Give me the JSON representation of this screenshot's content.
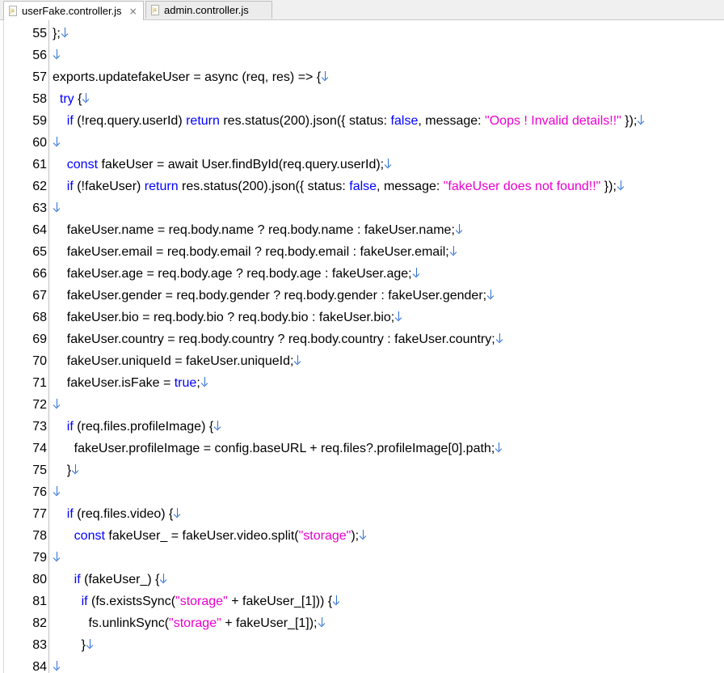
{
  "tabs": [
    {
      "label": "userFake.controller.js",
      "active": true,
      "closable": true
    },
    {
      "label": "admin.controller.js",
      "active": false,
      "closable": false
    }
  ],
  "close_glyph": "×",
  "colors": {
    "keyword": "#0000ff",
    "string": "#e800d0",
    "eol_marker": "#2b6fd6"
  },
  "lines": [
    {
      "n": "55",
      "segs": [
        [
          "t",
          "};"
        ]
      ]
    },
    {
      "n": "56",
      "segs": []
    },
    {
      "n": "57",
      "segs": [
        [
          "t",
          "exports.updatefakeUser = async (req, res) => {"
        ]
      ]
    },
    {
      "n": "58",
      "segs": [
        [
          "k",
          "  try"
        ],
        [
          "t",
          " {"
        ]
      ]
    },
    {
      "n": "59",
      "segs": [
        [
          "t",
          "    "
        ],
        [
          "k",
          "if"
        ],
        [
          "t",
          " (!req.query.userId) "
        ],
        [
          "k",
          "return"
        ],
        [
          "t",
          " res.status(200).json({ status: "
        ],
        [
          "k",
          "false"
        ],
        [
          "t",
          ", message: "
        ],
        [
          "s",
          "\"Oops ! Invalid details!!\""
        ],
        [
          "t",
          " });"
        ]
      ]
    },
    {
      "n": "60",
      "segs": []
    },
    {
      "n": "61",
      "segs": [
        [
          "t",
          "    "
        ],
        [
          "k",
          "const"
        ],
        [
          "t",
          " fakeUser = await User.findById(req.query.userId);"
        ]
      ]
    },
    {
      "n": "62",
      "segs": [
        [
          "t",
          "    "
        ],
        [
          "k",
          "if"
        ],
        [
          "t",
          " (!fakeUser) "
        ],
        [
          "k",
          "return"
        ],
        [
          "t",
          " res.status(200).json({ status: "
        ],
        [
          "k",
          "false"
        ],
        [
          "t",
          ", message: "
        ],
        [
          "s",
          "\"fakeUser does not found!!\""
        ],
        [
          "t",
          " });"
        ]
      ]
    },
    {
      "n": "63",
      "segs": []
    },
    {
      "n": "64",
      "segs": [
        [
          "t",
          "    fakeUser.name = req.body.name ? req.body.name : fakeUser.name;"
        ]
      ]
    },
    {
      "n": "65",
      "segs": [
        [
          "t",
          "    fakeUser.email = req.body.email ? req.body.email : fakeUser.email;"
        ]
      ]
    },
    {
      "n": "66",
      "segs": [
        [
          "t",
          "    fakeUser.age = req.body.age ? req.body.age : fakeUser.age;"
        ]
      ]
    },
    {
      "n": "67",
      "segs": [
        [
          "t",
          "    fakeUser.gender = req.body.gender ? req.body.gender : fakeUser.gender;"
        ]
      ]
    },
    {
      "n": "68",
      "segs": [
        [
          "t",
          "    fakeUser.bio = req.body.bio ? req.body.bio : fakeUser.bio;"
        ]
      ]
    },
    {
      "n": "69",
      "segs": [
        [
          "t",
          "    fakeUser.country = req.body.country ? req.body.country : fakeUser.country;"
        ]
      ]
    },
    {
      "n": "70",
      "segs": [
        [
          "t",
          "    fakeUser.uniqueId = fakeUser.uniqueId;"
        ]
      ]
    },
    {
      "n": "71",
      "segs": [
        [
          "t",
          "    fakeUser.isFake = "
        ],
        [
          "k",
          "true"
        ],
        [
          "t",
          ";"
        ]
      ]
    },
    {
      "n": "72",
      "segs": []
    },
    {
      "n": "73",
      "segs": [
        [
          "t",
          "    "
        ],
        [
          "k",
          "if"
        ],
        [
          "t",
          " (req.files.profileImage) {"
        ]
      ]
    },
    {
      "n": "74",
      "segs": [
        [
          "t",
          "      fakeUser.profileImage = config.baseURL + req.files?.profileImage[0].path;"
        ]
      ]
    },
    {
      "n": "75",
      "segs": [
        [
          "t",
          "    }"
        ]
      ]
    },
    {
      "n": "76",
      "segs": []
    },
    {
      "n": "77",
      "segs": [
        [
          "t",
          "    "
        ],
        [
          "k",
          "if"
        ],
        [
          "t",
          " (req.files.video) {"
        ]
      ]
    },
    {
      "n": "78",
      "segs": [
        [
          "t",
          "      "
        ],
        [
          "k",
          "const"
        ],
        [
          "t",
          " fakeUser_ = fakeUser.video.split("
        ],
        [
          "s",
          "\"storage\""
        ],
        [
          "t",
          ");"
        ]
      ]
    },
    {
      "n": "79",
      "segs": []
    },
    {
      "n": "80",
      "segs": [
        [
          "t",
          "      "
        ],
        [
          "k",
          "if"
        ],
        [
          "t",
          " (fakeUser_) {"
        ]
      ]
    },
    {
      "n": "81",
      "segs": [
        [
          "t",
          "        "
        ],
        [
          "k",
          "if"
        ],
        [
          "t",
          " (fs.existsSync("
        ],
        [
          "s",
          "\"storage\""
        ],
        [
          "t",
          " + fakeUser_[1])) {"
        ]
      ]
    },
    {
      "n": "82",
      "segs": [
        [
          "t",
          "          fs.unlinkSync("
        ],
        [
          "s",
          "\"storage\""
        ],
        [
          "t",
          " + fakeUser_[1]);"
        ]
      ]
    },
    {
      "n": "83",
      "segs": [
        [
          "t",
          "        }"
        ]
      ]
    },
    {
      "n": "84",
      "segs": []
    }
  ]
}
